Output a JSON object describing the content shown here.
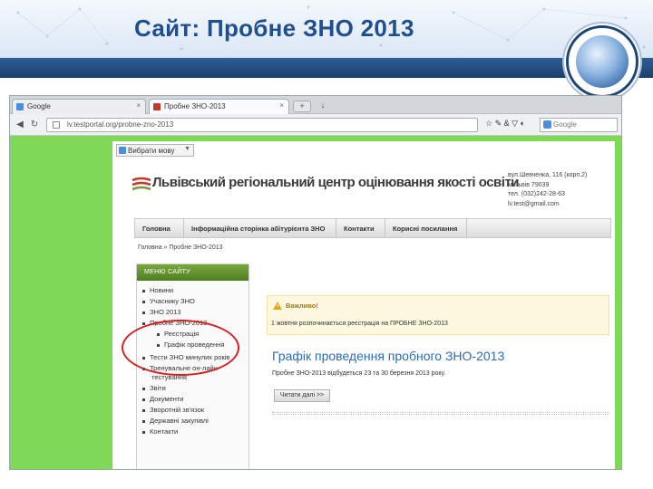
{
  "slide": {
    "title": "Сайт: Пробне ЗНО 2013"
  },
  "browser": {
    "tabs": [
      {
        "label": "Google"
      },
      {
        "label": "Пробне ЗНО-2013"
      }
    ],
    "new_tab": "+",
    "minus": "↓",
    "address": "lv.testportal.org/probne-zno-2013",
    "tools": "☆ ✎ & ▽ ◐",
    "search_placeholder": "Google"
  },
  "page": {
    "language_select": "Вибрати мову",
    "org_name": "Львівський регіональний центр оцінювання якості освіти",
    "contact": [
      "вул.Шевченка, 116 (корп.2)",
      "м.Львів 79039",
      "тел. (032)242-28-63",
      "lv.test@gmail.com"
    ],
    "menu": [
      "Головна",
      "Інформаційна сторінка абітурієнта ЗНО",
      "Контакти",
      "Корисні посилання"
    ],
    "breadcrumb": "Головна » Пробне ЗНО-2013",
    "sidebar": {
      "heading": "МЕНЮ САЙТУ",
      "items": [
        "Новини",
        "Учасникy ЗНО",
        "ЗНО 2013",
        "Пробне ЗНО-2013",
        "Реєстрація",
        "Графік проведення",
        "Тести ЗНО минулих років",
        "Тренувальне он-лайн",
        "тестування",
        "Звіти",
        "Документи",
        "Зворотній зв'язок",
        "Державні закупівлі",
        "Контакти"
      ]
    },
    "alert": {
      "title": "Важливо!",
      "text": "1 жовтня розпочинається реєстрація на ПРОБНЕ ЗНО-2013"
    },
    "news": {
      "title": "Графік проведення пробного ЗНО-2013",
      "text": "Пробне ЗНО-2013 відбудеться 23 та 30 березня 2013 року.",
      "button": "Читати далі >>"
    }
  },
  "colors": {
    "header_bar": "#1b3f6d",
    "title": "#1f4f8f",
    "screenshot_bg": "#7ed957",
    "sidebar_head": "#5c8a2a",
    "annotation": "#d42020",
    "news_title": "#2b6cb0"
  }
}
